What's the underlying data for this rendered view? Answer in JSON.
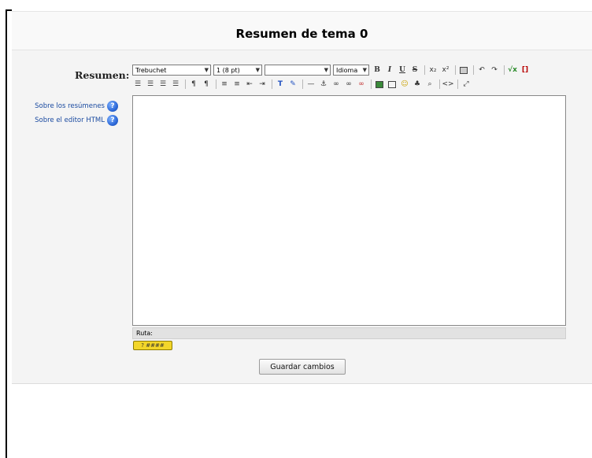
{
  "header": {
    "title": "Resumen de tema 0"
  },
  "form": {
    "field_label": "Resumen:",
    "help_links": [
      "Sobre los resúmenes",
      "Sobre el editor HTML"
    ],
    "help_icon": "?"
  },
  "toolbar": {
    "font_family": "Trebuchet",
    "font_size": "1 (8 pt)",
    "format": "",
    "language": "Idioma",
    "bold": "B",
    "italic": "I",
    "underline": "U",
    "strike": "S"
  },
  "editor": {
    "content": ""
  },
  "pathbar": {
    "label": "Ruta:"
  },
  "keyboard_button": {
    "label": "? ####"
  },
  "save_button": {
    "label": "Guardar cambios"
  }
}
